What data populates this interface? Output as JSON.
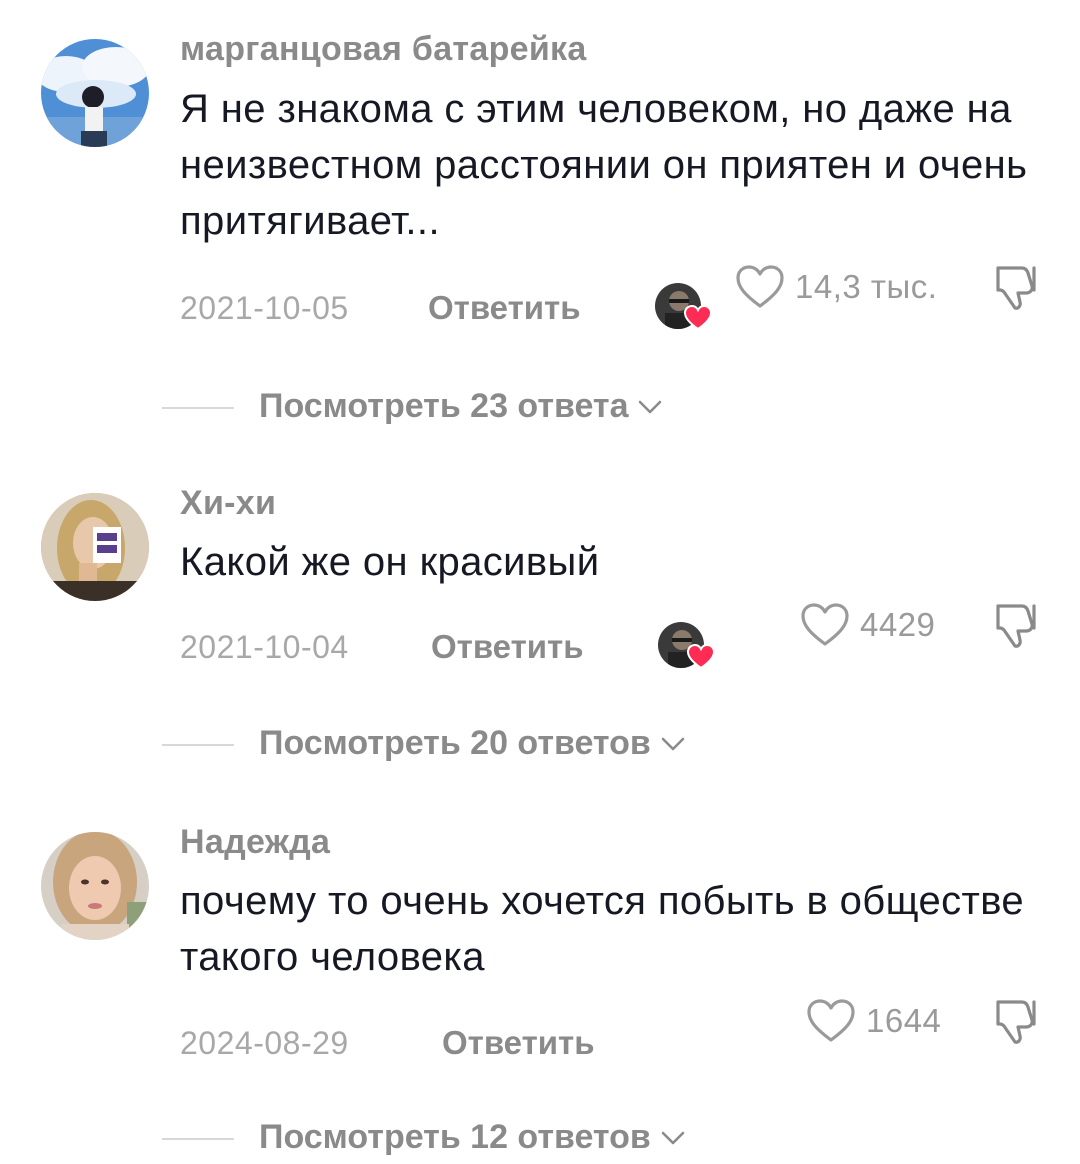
{
  "comments": [
    {
      "username": "марганцовая батарейка",
      "text": "Я не знакома с этим человеком, но даже на неизвестном расстоянии он приятен и очень притягивает...",
      "date": "2021-10-05",
      "reply_label": "Ответить",
      "likes": "14,3 тыс.",
      "view_replies": "Посмотреть 23 ответа"
    },
    {
      "username": "Хи-хи",
      "text": "Какой же он красивый",
      "date": "2021-10-04",
      "reply_label": "Ответить",
      "likes": "4429",
      "view_replies": "Посмотреть 20 ответов"
    },
    {
      "username": "Надежда",
      "text": "почему то очень хочется побыть в обществе такого человека",
      "date": "2024-08-29",
      "reply_label": "Ответить",
      "likes": "1644",
      "view_replies": "Посмотреть 12 ответов"
    }
  ],
  "colors": {
    "username": "#8a8a8a",
    "text": "#161823",
    "muted": "#a8a8a8",
    "heart_badge": "#fe2c55"
  },
  "icons": [
    "heart-outline-icon",
    "dislike-icon",
    "chevron-down-icon",
    "creator-liked-heart-icon"
  ]
}
